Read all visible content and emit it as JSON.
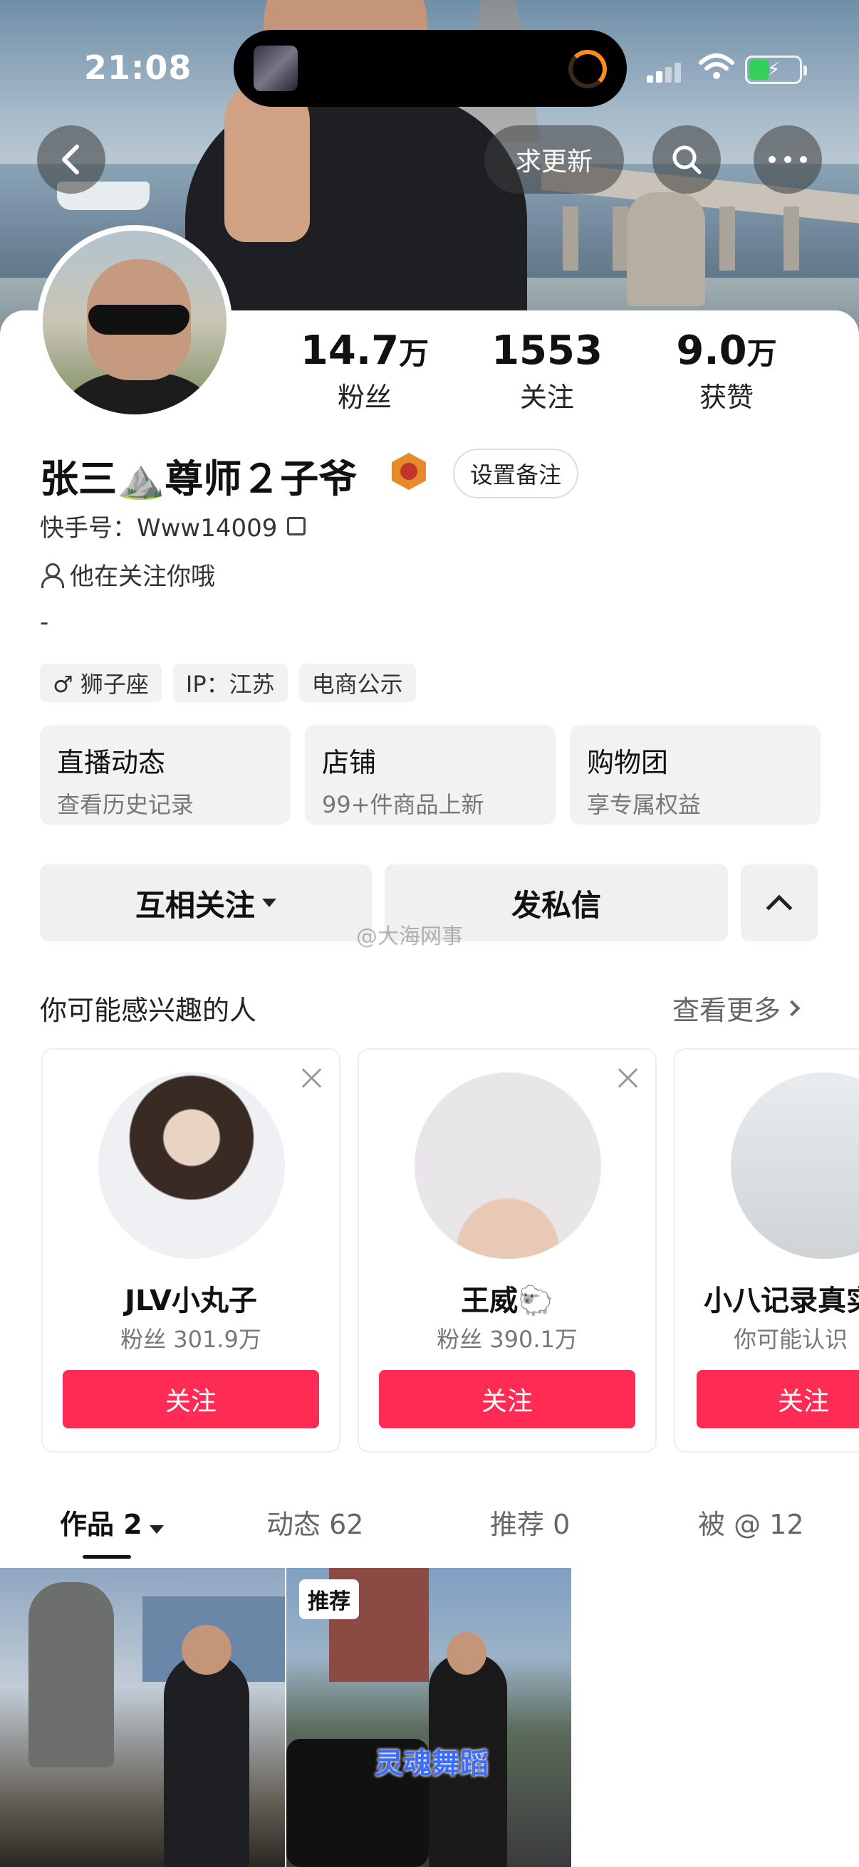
{
  "status_bar": {
    "time": "21:08"
  },
  "nav": {
    "refresh_label": "求更新"
  },
  "stats": [
    {
      "num": "14.7",
      "unit": "万",
      "label": "粉丝"
    },
    {
      "num": "1553",
      "unit": "",
      "label": "关注"
    },
    {
      "num": "9.0",
      "unit": "万",
      "label": "获赞"
    }
  ],
  "profile": {
    "name": "张三⛰️尊师２子爷",
    "remark_label": "设置备注",
    "uid": "快手号：Www14009",
    "following_text": "他在关注你哦",
    "bio": "-"
  },
  "tags": [
    "♂ 狮子座",
    "IP：江苏",
    "电商公示"
  ],
  "features": [
    {
      "title": "直播动态",
      "sub": "查看历史记录"
    },
    {
      "title": "店铺",
      "sub": "99+件商品上新"
    },
    {
      "title": "购物团",
      "sub": "享专属权益"
    }
  ],
  "actions": {
    "mutual_follow": "互相关注",
    "message": "发私信"
  },
  "watermark": "@大海网事",
  "recommend": {
    "title": "你可能感兴趣的人",
    "more": "查看更多",
    "cards": [
      {
        "name": "JLV小丸子",
        "sub": "粉丝 301.9万",
        "follow": "关注"
      },
      {
        "name": "王威🐑",
        "sub": "粉丝 390.1万",
        "follow": "关注"
      },
      {
        "name": "小八记录真实",
        "sub": "你可能认识",
        "follow": "关注"
      }
    ]
  },
  "tabs": [
    {
      "label": "作品 2"
    },
    {
      "label": "动态 62"
    },
    {
      "label": "推荐 0"
    },
    {
      "label": "被 @ 12"
    }
  ],
  "grid": {
    "badge": "推荐",
    "video_text": "灵魂舞蹈"
  }
}
